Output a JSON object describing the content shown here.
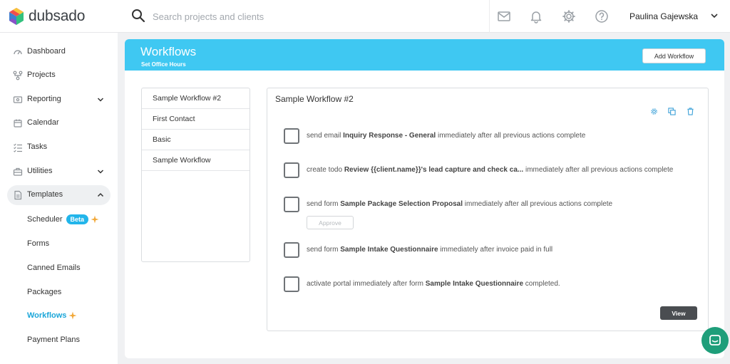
{
  "brand": {
    "name": "dubsado"
  },
  "search": {
    "placeholder": "Search projects and clients"
  },
  "header": {
    "user_name": "Paulina Gajewska"
  },
  "sidebar": {
    "items": [
      {
        "label": "Dashboard"
      },
      {
        "label": "Projects"
      },
      {
        "label": "Reporting"
      },
      {
        "label": "Calendar"
      },
      {
        "label": "Tasks"
      },
      {
        "label": "Utilities"
      },
      {
        "label": "Templates"
      }
    ],
    "sub_items": [
      {
        "label": "Scheduler",
        "badge": "Beta"
      },
      {
        "label": "Forms"
      },
      {
        "label": "Canned Emails"
      },
      {
        "label": "Packages"
      },
      {
        "label": "Workflows"
      },
      {
        "label": "Payment Plans"
      }
    ]
  },
  "page": {
    "title": "Workflows",
    "subtitle": "Set Office Hours",
    "add_button": "Add Workflow"
  },
  "workflow_list": [
    "Sample Workflow #2",
    "First Contact",
    "Basic",
    "Sample Workflow"
  ],
  "detail": {
    "title": "Sample Workflow #2",
    "actions": [
      {
        "pre": "send email",
        "bold": "Inquiry Response - General",
        "post": "immediately after all previous actions complete"
      },
      {
        "pre": "create todo",
        "bold": "Review {{client.name}}'s lead capture and check ca...",
        "post": "immediately after all previous actions complete"
      },
      {
        "pre": "send form",
        "bold": "Sample Package Selection Proposal",
        "post": "immediately after all previous actions complete",
        "button": "Approve"
      },
      {
        "pre": "send form",
        "bold": "Sample Intake Questionnaire",
        "post": "immediately after invoice paid in full"
      },
      {
        "pre": "activate portal immediately after form",
        "bold": "Sample Intake Questionnaire",
        "post": "completed."
      }
    ],
    "view_button": "View"
  },
  "colors": {
    "banner": "#3fc8f2",
    "active_link": "#1ba6d9",
    "badge": "#22b5ea",
    "chat": "#1e9e7a",
    "sparkle": "#f2a93b"
  },
  "icons": [
    "search-icon",
    "mail-icon",
    "bell-icon",
    "gear-icon",
    "help-icon",
    "chevron-down-icon",
    "sparkle-icon",
    "settings-icon",
    "duplicate-icon",
    "trash-icon",
    "chat-icon"
  ]
}
